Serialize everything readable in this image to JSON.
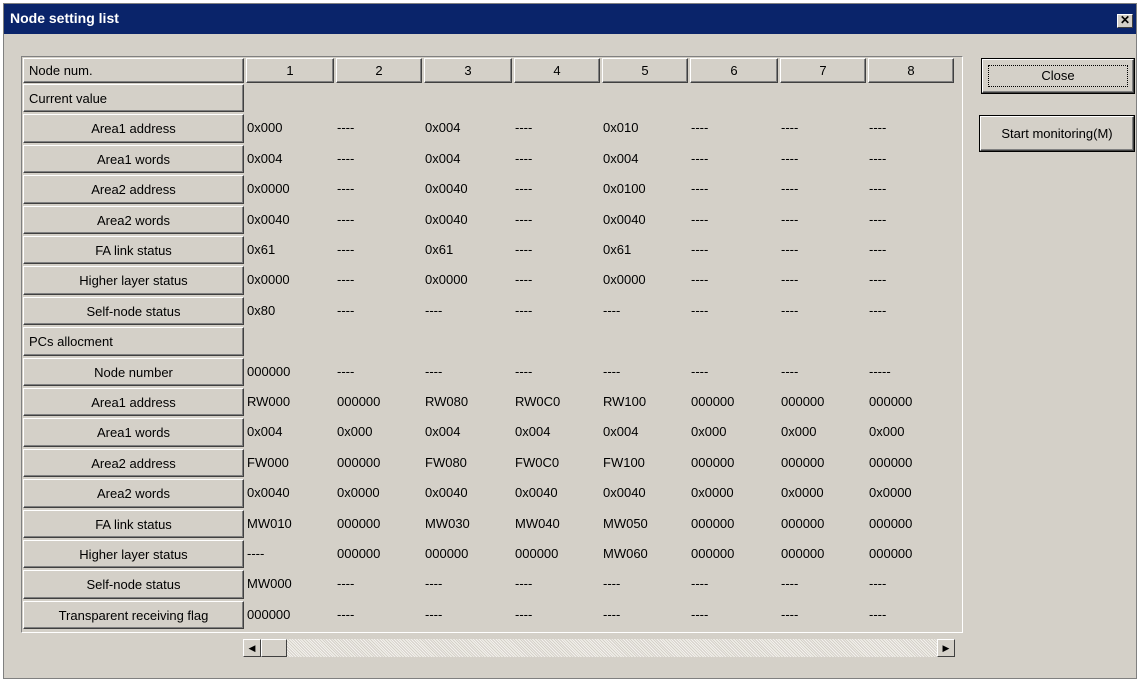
{
  "window": {
    "title": "Node setting list"
  },
  "buttons": {
    "close": "Close",
    "monitor": "Start monitoring(M)"
  },
  "table": {
    "corner": "Node num.",
    "columns": [
      "1",
      "2",
      "3",
      "4",
      "5",
      "6",
      "7",
      "8"
    ],
    "rows": [
      {
        "label": "Current value",
        "section": true,
        "values": []
      },
      {
        "label": "Area1 address",
        "values": [
          "0x000",
          "----",
          "0x004",
          "----",
          "0x010",
          "----",
          "----",
          "----"
        ]
      },
      {
        "label": "Area1 words",
        "values": [
          "0x004",
          "----",
          "0x004",
          "----",
          "0x004",
          "----",
          "----",
          "----"
        ]
      },
      {
        "label": "Area2 address",
        "values": [
          "0x0000",
          "----",
          "0x0040",
          "----",
          "0x0100",
          "----",
          "----",
          "----"
        ]
      },
      {
        "label": "Area2 words",
        "values": [
          "0x0040",
          "----",
          "0x0040",
          "----",
          "0x0040",
          "----",
          "----",
          "----"
        ]
      },
      {
        "label": "FA link status",
        "values": [
          "0x61",
          "----",
          "0x61",
          "----",
          "0x61",
          "----",
          "----",
          "----"
        ]
      },
      {
        "label": "Higher layer status",
        "values": [
          "0x0000",
          "----",
          "0x0000",
          "----",
          "0x0000",
          "----",
          "----",
          "----"
        ]
      },
      {
        "label": "Self-node status",
        "values": [
          "0x80",
          "----",
          "----",
          "----",
          "----",
          "----",
          "----",
          "----"
        ]
      },
      {
        "label": "PCs allocment",
        "section": true,
        "values": []
      },
      {
        "label": "Node number",
        "values": [
          "000000",
          "----",
          "----",
          "----",
          "----",
          "----",
          "----",
          "-----"
        ]
      },
      {
        "label": "Area1 address",
        "values": [
          "RW000",
          "000000",
          "RW080",
          "RW0C0",
          "RW100",
          "000000",
          "000000",
          "000000"
        ]
      },
      {
        "label": "Area1 words",
        "values": [
          "0x004",
          "0x000",
          "0x004",
          "0x004",
          "0x004",
          "0x000",
          "0x000",
          "0x000"
        ]
      },
      {
        "label": "Area2 address",
        "values": [
          "FW000",
          "000000",
          "FW080",
          "FW0C0",
          "FW100",
          "000000",
          "000000",
          "000000"
        ]
      },
      {
        "label": "Area2 words",
        "values": [
          "0x0040",
          "0x0000",
          "0x0040",
          "0x0040",
          "0x0040",
          "0x0000",
          "0x0000",
          "0x0000"
        ]
      },
      {
        "label": "FA link status",
        "values": [
          "MW010",
          "000000",
          "MW030",
          "MW040",
          "MW050",
          "000000",
          "000000",
          "000000"
        ]
      },
      {
        "label": "Higher layer status",
        "values": [
          "----",
          "000000",
          "000000",
          "000000",
          "MW060",
          "000000",
          "000000",
          "000000"
        ]
      },
      {
        "label": "Self-node status",
        "values": [
          "MW000",
          "----",
          "----",
          "----",
          "----",
          "----",
          "----",
          "----"
        ]
      },
      {
        "label": "Transparent receiving flag",
        "values": [
          "000000",
          "----",
          "----",
          "----",
          "----",
          "----",
          "----",
          "----"
        ]
      }
    ]
  },
  "scrollbar": {
    "left_arrow": "◀",
    "right_arrow": "▶"
  }
}
